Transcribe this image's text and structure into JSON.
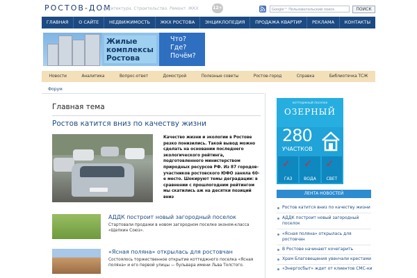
{
  "header": {
    "logo": "РОСТОВ-ДОМ",
    "tagline": "Архитектура. Строительство. Ремонт. ЖКХ",
    "age_badge": "12+",
    "search_placeholder": "Google™ Пользовательский поиск",
    "search_button": "ПОИСК"
  },
  "main_nav": [
    "ГЛАВНАЯ",
    "О САЙТЕ",
    "НЕДВИЖИМОСТЬ",
    "ЖКХ РОСТОВА",
    "ЭНЦИКЛОПЕДИЯ",
    "ПРОДАЖА КВАРТИР",
    "РЕКЛАМА",
    "КОНТАКТЫ"
  ],
  "banner": {
    "left_text": "Жилые комплексы Ростова",
    "right_lines": [
      "Что?",
      "Где?",
      "Почём?"
    ]
  },
  "sub_nav": [
    "Новости",
    "Аналитика",
    "Вопрос-ответ",
    "Домострой",
    "Полезные советы",
    "Ростов-город",
    "Справка",
    "Библиотечка ТСЖ"
  ],
  "sub_nav2": "Форум",
  "main": {
    "section_title": "Главная тема",
    "article_title": "Ростов катится вниз по качеству жизни",
    "article_text": "Качество жизни и экологии в Ростове резко понизились. Такой вывод можно сделать на основании последнего экологического рейтинга, подготовленного министерством природных ресурсов РФ. Из 87 городов-участников ростовского ЮФО заняла 60-е место. Шокируют темы деградации: в сравнении с прошлогодним рейтингом мы скатились аж на десятки позиций вниз",
    "news": [
      {
        "title": "АДДК построит новый загородный поселок",
        "text": "Стартовали продажи в новом загородном поселке эконом-класса «Щепкин Союз»."
      },
      {
        "title": "«Ясная поляна» открылась для ростовчан",
        "text": "Состоялось торжественное открытие коттеджного поселка «Ясная поляна» и его первой улицы — бульвара имени Льва Толстого."
      }
    ]
  },
  "sidebar": {
    "ad": {
      "small": "коттеджный поселок",
      "name": "ОЗЕРНЫЙ",
      "number": "280",
      "unit": "УЧАСТКОВ",
      "cells": [
        "ГАЗ",
        "ВОДА",
        "СВЕТ"
      ]
    },
    "feed_title": "ЛЕНТА НОВОСТЕЙ",
    "feed": [
      "Ростов катится вниз по качеству жизни",
      "АДДК построит новый загородный поселок",
      "«Ясная поляна» открылась для ростовчан",
      "В Ростове начинают кочегарить",
      "Храм Благовещения увенчали крестами",
      "«Энергосбыт» ждет от клиентов СМС-ки"
    ]
  }
}
